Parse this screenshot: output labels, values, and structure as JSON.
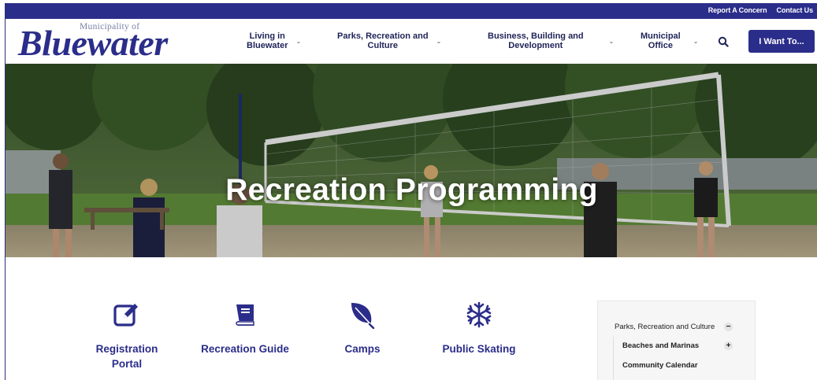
{
  "utility": {
    "links": [
      "Report A Concern",
      "Contact Us"
    ]
  },
  "logo": {
    "top": "Municipality of",
    "main": "Bluewater"
  },
  "nav": {
    "items": [
      {
        "label_line1": "Living in",
        "label_line2": "Bluewater"
      },
      {
        "label_line1": "Parks, Recreation and",
        "label_line2": "Culture"
      },
      {
        "label_line1": "Business, Building and",
        "label_line2": "Development"
      },
      {
        "label_line1": "Municipal",
        "label_line2": "Office"
      }
    ],
    "search_icon": "search-icon",
    "cta_label": "I Want To..."
  },
  "hero": {
    "title": "Recreation Programming"
  },
  "quick_links": [
    {
      "label_line1": "Registration",
      "label_line2": "Portal",
      "icon": "edit-icon"
    },
    {
      "label_line1": "Recreation Guide",
      "label_line2": "",
      "icon": "book-icon"
    },
    {
      "label_line1": "Camps",
      "label_line2": "",
      "icon": "leaf-icon"
    },
    {
      "label_line1": "Public Skating",
      "label_line2": "",
      "icon": "snowflake-icon"
    }
  ],
  "side_menu": {
    "parent": {
      "label": "Parks, Recreation and Culture",
      "toggle": "−"
    },
    "children": [
      {
        "label": "Beaches and Marinas",
        "toggle": "+"
      },
      {
        "label": "Community Calendar"
      }
    ]
  },
  "colors": {
    "brand": "#2b2d8a",
    "nav_text": "#1f2358",
    "side_bg": "#f6f6f6"
  }
}
